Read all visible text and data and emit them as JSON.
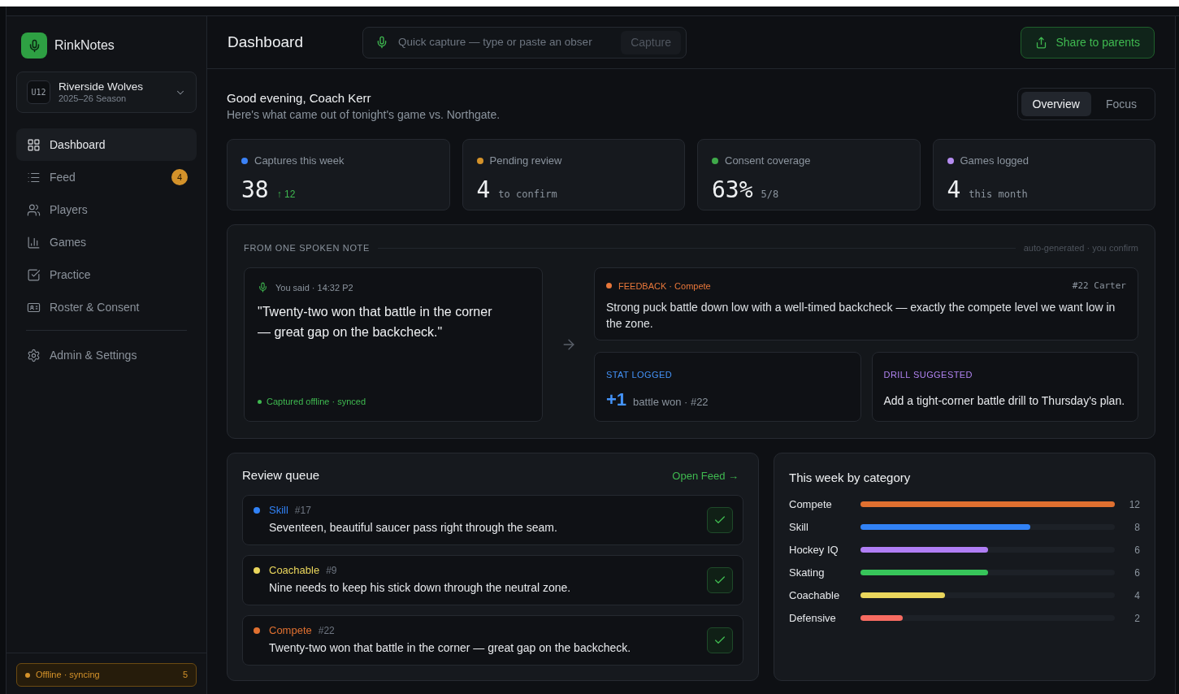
{
  "sidebar": {
    "brand": "RinkNotes",
    "team": {
      "badge": "U12",
      "name": "Riverside Wolves",
      "season": "2025–26 Season"
    },
    "nav": [
      {
        "label": "Dashboard",
        "selected": true
      },
      {
        "label": "Feed",
        "selected": false,
        "count": "4"
      },
      {
        "label": "Players",
        "selected": false
      },
      {
        "label": "Games",
        "selected": false
      },
      {
        "label": "Practice",
        "selected": false
      },
      {
        "label": "Roster & Consent",
        "selected": false
      }
    ],
    "settings": {
      "label": "Admin & Settings",
      "selected": false
    },
    "sync_status": {
      "label": "Offline · syncing",
      "count": "5"
    }
  },
  "header": {
    "title": "Dashboard",
    "quick_capture": {
      "placeholder": "Quick capture — type or paste an obser",
      "button": {
        "label": "Capture",
        "disabled": true
      }
    },
    "share_button": "Share to parents"
  },
  "greeting": {
    "title": "Good evening, Coach Kerr",
    "subtitle": "Here's what came out of tonight's game vs. Northgate."
  },
  "view_toggle": [
    {
      "label": "Overview",
      "selected": true
    },
    {
      "label": "Focus",
      "selected": false
    }
  ],
  "stats": [
    {
      "label": "Captures this week",
      "color": "#3b82f6",
      "value": "38",
      "kind": "delta",
      "detail": "↑ 12"
    },
    {
      "label": "Pending review",
      "color": "#d4922a",
      "value": "4",
      "kind": "note",
      "detail": "to confirm"
    },
    {
      "label": "Consent coverage",
      "color": "#3fa94a",
      "value": "63%",
      "kind": "note",
      "detail": "5/8"
    },
    {
      "label": "Games logged",
      "color": "#b58cf0",
      "value": "4",
      "kind": "note",
      "detail": "this month"
    }
  ],
  "spoken_note": {
    "title": "FROM ONE SPOKEN NOTE",
    "note": "auto-generated · you confirm",
    "source": {
      "meta": "You said · 14:32 P2",
      "quote": "\"Twenty-two won that battle in the corner — great gap on the backcheck.\"",
      "status": "Captured offline · synced"
    },
    "outputs": [
      {
        "kind": "feedback",
        "color": "#e8773a",
        "label": "FEEDBACK · Compete",
        "player": "#22 Carter",
        "text": "Strong puck battle down low with a well-timed backcheck — exactly the compete level we want low in the zone."
      },
      {
        "kind": "stat",
        "color": "#4493f8",
        "label": "STAT LOGGED",
        "value": "+1",
        "detail": "battle won · #22"
      },
      {
        "kind": "drill",
        "color": "#b083f0",
        "label": "DRILL SUGGESTED",
        "text": "Add a tight-corner battle drill to Thursday's plan."
      }
    ]
  },
  "review_queue": {
    "title": "Review queue",
    "link": "Open Feed →",
    "items": [
      {
        "category": "Skill",
        "color": "#3182f6",
        "player": "#17",
        "text": "Seventeen, beautiful saucer pass right through the seam."
      },
      {
        "category": "Coachable",
        "color": "#ead65c",
        "player": "#9",
        "text": "Nine needs to keep his stick down through the neutral zone."
      },
      {
        "category": "Compete",
        "color": "#e07030",
        "player": "#22",
        "text": "Twenty-two won that battle in the corner — great gap on the backcheck."
      }
    ]
  },
  "categories": {
    "title": "This week by category",
    "rows": [
      {
        "label": "Compete",
        "color": "#e07030",
        "level": 1,
        "value": "12"
      },
      {
        "label": "Skill",
        "color": "#3182f6",
        "level": 0.667,
        "value": "8"
      },
      {
        "label": "Hockey IQ",
        "color": "#b07ef5",
        "level": 0.5,
        "value": "6"
      },
      {
        "label": "Skating",
        "color": "#37c55a",
        "level": 0.5,
        "value": "6"
      },
      {
        "label": "Coachable",
        "color": "#ead65c",
        "level": 0.333,
        "value": "4"
      },
      {
        "label": "Defensive",
        "color": "#f76b61",
        "level": 0.167,
        "value": "2"
      }
    ]
  }
}
